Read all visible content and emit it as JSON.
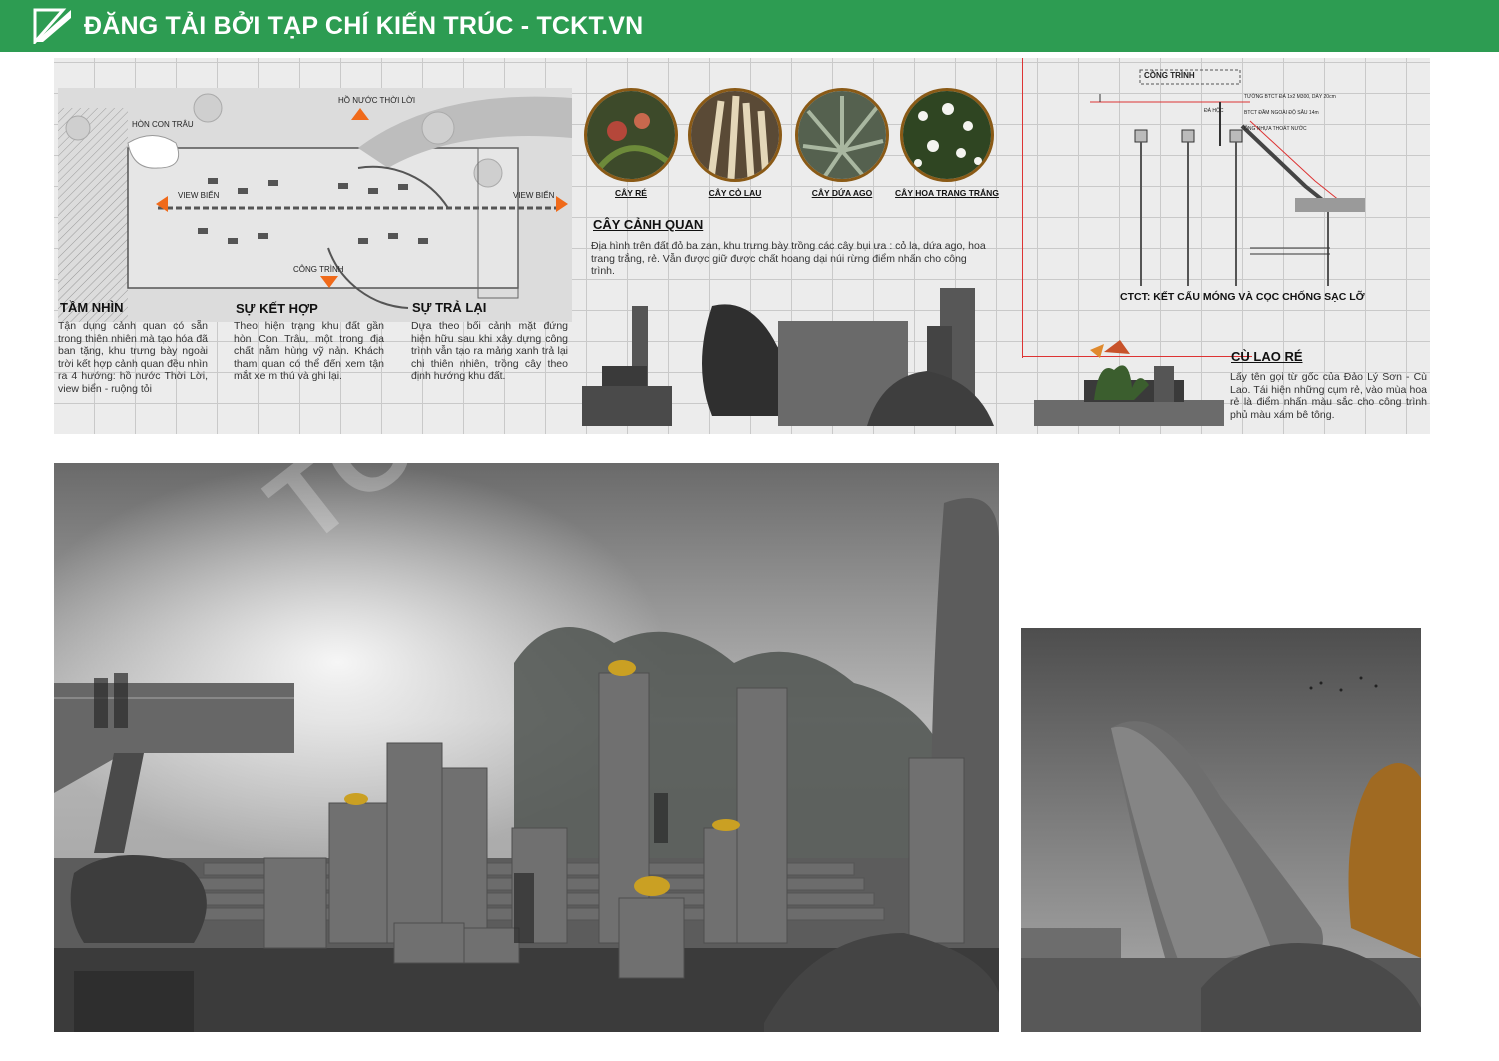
{
  "header": {
    "title": "ĐĂNG TẢI BỞI TẠP CHÍ KIẾN TRÚC - TCKT.VN"
  },
  "plan": {
    "labels": {
      "ho_nuoc": "HỒ NƯỚC THỜI LỜI",
      "hon_con_trau": "HÒN CON TRÂU",
      "view_bien_left": "VIEW BIỂN",
      "view_bien_right": "VIEW BIỂN",
      "cong_trinh": "CÔNG TRÌNH"
    }
  },
  "sections": [
    {
      "title": "TẦM NHÌN",
      "text": "Tận dụng cảnh quan có sẵn trong thiên nhiên mà tạo hóa đã ban tặng, khu trưng bày ngoài trời kết hợp cảnh quan đều nhìn ra 4 hướng: hồ nước Thời Lời, view biển - ruộng tỏi"
    },
    {
      "title": "SỰ KẾT HỢP",
      "text": "Theo hiện trạng khu đất gần hòn Con Trâu, một trong địa chất nằm hùng vỹ nản. Khách tham quan có thể đến xem tận mắt xe m thú và ghi lại."
    },
    {
      "title": "SỰ TRẢ LẠI",
      "text": "Dựa theo bối cảnh mặt đứng hiện hữu sau khi xây dựng công trình vẫn tạo ra mảng xanh trả lại chi thiên nhiên, trồng cây theo định hướng khu đất."
    }
  ],
  "plants": [
    {
      "label": "CÂY RÉ",
      "color": "#7a3a2a"
    },
    {
      "label": "CÂY CỎ LAU",
      "color": "#8c7a58"
    },
    {
      "label": "CÂY DỨA AGO",
      "color": "#6f7d6e"
    },
    {
      "label": "CÂY HOA TRANG TRẮNG",
      "color": "#3f5a2d"
    }
  ],
  "landscape": {
    "title": "CÂY CẢNH QUAN",
    "text": "Địa hình trên đất đỏ ba zan, khu trưng bày trồng các cây bụi ưa : cỏ la, dứa ago, hoa trang trắng, rẻ. Vẫn được giữ được chất hoang dại núi rừng điểm nhấn cho công trình."
  },
  "detail": {
    "header_label": "CÔNG TRÌNH",
    "caption": "CTCT: KẾT CẤU MÓNG VÀ CỌC CHỐNG SẠC LỠ",
    "notes": [
      "TƯỜNG BTCT ĐÁ 1x2 M300, DÀY 20cm",
      "BTCT ĐẦM NGOÀI ĐỘ SÂU 14m",
      "ỐNG NHỰA THOÁT NƯỚC",
      "ĐÁ HỘC"
    ]
  },
  "cu_lao_re": {
    "title": "CÙ LAO RÉ",
    "text": "Lấy tên gọi từ gốc của Đảo Lý Sơn - Cù Lao. Tái hiện những cụm rẻ, vào mùa hoa rẻ là điểm nhấn màu sắc cho công trình phủ màu xám bê tông."
  },
  "watermark": "TCKT.VN",
  "colors": {
    "brand_green": "#2d9c52",
    "accent_orange": "#f06a1a",
    "frame_brown": "#8a5a16"
  }
}
